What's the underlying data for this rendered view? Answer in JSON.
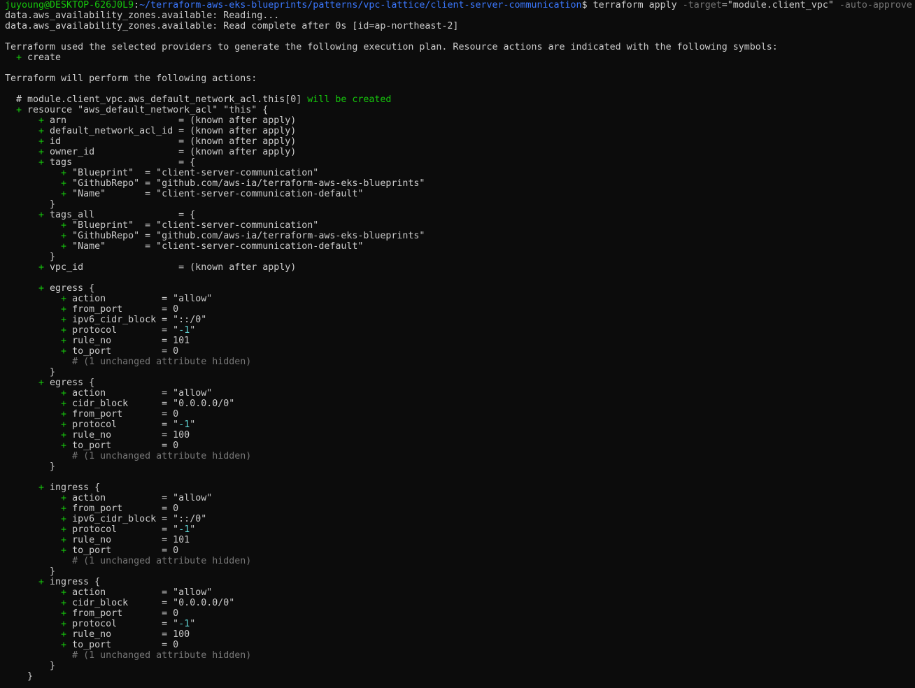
{
  "terminal": {
    "prompt": {
      "user_host": "juyoung@DESKTOP-626J0L9",
      "sep": ":",
      "path": "~/terraform-aws-eks-blueprints/patterns/vpc-lattice/client-server-communication",
      "dollar": "$ ",
      "command": "terraform apply ",
      "flag1": "-target",
      "flag1_value": "=\"module.client_vpc\" ",
      "flag2": "-auto-approve"
    },
    "colors": {
      "fg": "#cccccc",
      "green": "#16c60c",
      "blue": "#3b78ff",
      "cyan": "#61d6d6",
      "dim": "#767676",
      "background": "#0c0c0c"
    },
    "lines": [
      [
        {
          "t": "data.aws_availability_zones.available: Reading...",
          "c": "fg"
        }
      ],
      [
        {
          "t": "data.aws_availability_zones.available: Read complete after 0s [id=ap-northeast-2]",
          "c": "fg"
        }
      ],
      [],
      [
        {
          "t": "Terraform used the selected providers to generate the following execution plan. Resource actions are indicated with the following symbols:",
          "c": "fg"
        }
      ],
      [
        {
          "t": "  + ",
          "c": "grn"
        },
        {
          "t": "create",
          "c": "fg"
        }
      ],
      [],
      [
        {
          "t": "Terraform will perform the following actions:",
          "c": "fg"
        }
      ],
      [],
      [
        {
          "t": "  # module.client_vpc.aws_default_network_acl.this[0] ",
          "c": "fg"
        },
        {
          "t": "will be created",
          "c": "grn"
        }
      ],
      [
        {
          "t": "  + ",
          "c": "grn"
        },
        {
          "t": "resource \"aws_default_network_acl\" \"this\" {",
          "c": "fg"
        }
      ],
      [
        {
          "t": "      + ",
          "c": "grn"
        },
        {
          "t": "arn                    = (known after apply)",
          "c": "fg"
        }
      ],
      [
        {
          "t": "      + ",
          "c": "grn"
        },
        {
          "t": "default_network_acl_id = (known after apply)",
          "c": "fg"
        }
      ],
      [
        {
          "t": "      + ",
          "c": "grn"
        },
        {
          "t": "id                     = (known after apply)",
          "c": "fg"
        }
      ],
      [
        {
          "t": "      + ",
          "c": "grn"
        },
        {
          "t": "owner_id               = (known after apply)",
          "c": "fg"
        }
      ],
      [
        {
          "t": "      + ",
          "c": "grn"
        },
        {
          "t": "tags                   = {",
          "c": "fg"
        }
      ],
      [
        {
          "t": "          + ",
          "c": "grn"
        },
        {
          "t": "\"Blueprint\"  = \"client-server-communication\"",
          "c": "fg"
        }
      ],
      [
        {
          "t": "          + ",
          "c": "grn"
        },
        {
          "t": "\"GithubRepo\" = \"github.com/aws-ia/terraform-aws-eks-blueprints\"",
          "c": "fg"
        }
      ],
      [
        {
          "t": "          + ",
          "c": "grn"
        },
        {
          "t": "\"Name\"       = \"client-server-communication-default\"",
          "c": "fg"
        }
      ],
      [
        {
          "t": "        }",
          "c": "fg"
        }
      ],
      [
        {
          "t": "      + ",
          "c": "grn"
        },
        {
          "t": "tags_all               = {",
          "c": "fg"
        }
      ],
      [
        {
          "t": "          + ",
          "c": "grn"
        },
        {
          "t": "\"Blueprint\"  = \"client-server-communication\"",
          "c": "fg"
        }
      ],
      [
        {
          "t": "          + ",
          "c": "grn"
        },
        {
          "t": "\"GithubRepo\" = \"github.com/aws-ia/terraform-aws-eks-blueprints\"",
          "c": "fg"
        }
      ],
      [
        {
          "t": "          + ",
          "c": "grn"
        },
        {
          "t": "\"Name\"       = \"client-server-communication-default\"",
          "c": "fg"
        }
      ],
      [
        {
          "t": "        }",
          "c": "fg"
        }
      ],
      [
        {
          "t": "      + ",
          "c": "grn"
        },
        {
          "t": "vpc_id                 = (known after apply)",
          "c": "fg"
        }
      ],
      [],
      [
        {
          "t": "      + ",
          "c": "grn"
        },
        {
          "t": "egress {",
          "c": "fg"
        }
      ],
      [
        {
          "t": "          + ",
          "c": "grn"
        },
        {
          "t": "action          = \"allow\"",
          "c": "fg"
        }
      ],
      [
        {
          "t": "          + ",
          "c": "grn"
        },
        {
          "t": "from_port       = 0",
          "c": "fg"
        }
      ],
      [
        {
          "t": "          + ",
          "c": "grn"
        },
        {
          "t": "ipv6_cidr_block = \"::/0\"",
          "c": "fg"
        }
      ],
      [
        {
          "t": "          + ",
          "c": "grn"
        },
        {
          "t": "protocol        = \"",
          "c": "fg"
        },
        {
          "t": "-1",
          "c": "cyn"
        },
        {
          "t": "\"",
          "c": "fg"
        }
      ],
      [
        {
          "t": "          + ",
          "c": "grn"
        },
        {
          "t": "rule_no         = 101",
          "c": "fg"
        }
      ],
      [
        {
          "t": "          + ",
          "c": "grn"
        },
        {
          "t": "to_port         = 0",
          "c": "fg"
        }
      ],
      [
        {
          "t": "            # (1 unchanged attribute hidden)",
          "c": "dim"
        }
      ],
      [
        {
          "t": "        }",
          "c": "fg"
        }
      ],
      [
        {
          "t": "      + ",
          "c": "grn"
        },
        {
          "t": "egress {",
          "c": "fg"
        }
      ],
      [
        {
          "t": "          + ",
          "c": "grn"
        },
        {
          "t": "action          = \"allow\"",
          "c": "fg"
        }
      ],
      [
        {
          "t": "          + ",
          "c": "grn"
        },
        {
          "t": "cidr_block      = \"0.0.0.0/0\"",
          "c": "fg"
        }
      ],
      [
        {
          "t": "          + ",
          "c": "grn"
        },
        {
          "t": "from_port       = 0",
          "c": "fg"
        }
      ],
      [
        {
          "t": "          + ",
          "c": "grn"
        },
        {
          "t": "protocol        = \"",
          "c": "fg"
        },
        {
          "t": "-1",
          "c": "cyn"
        },
        {
          "t": "\"",
          "c": "fg"
        }
      ],
      [
        {
          "t": "          + ",
          "c": "grn"
        },
        {
          "t": "rule_no         = 100",
          "c": "fg"
        }
      ],
      [
        {
          "t": "          + ",
          "c": "grn"
        },
        {
          "t": "to_port         = 0",
          "c": "fg"
        }
      ],
      [
        {
          "t": "            # (1 unchanged attribute hidden)",
          "c": "dim"
        }
      ],
      [
        {
          "t": "        }",
          "c": "fg"
        }
      ],
      [],
      [
        {
          "t": "      + ",
          "c": "grn"
        },
        {
          "t": "ingress {",
          "c": "fg"
        }
      ],
      [
        {
          "t": "          + ",
          "c": "grn"
        },
        {
          "t": "action          = \"allow\"",
          "c": "fg"
        }
      ],
      [
        {
          "t": "          + ",
          "c": "grn"
        },
        {
          "t": "from_port       = 0",
          "c": "fg"
        }
      ],
      [
        {
          "t": "          + ",
          "c": "grn"
        },
        {
          "t": "ipv6_cidr_block = \"::/0\"",
          "c": "fg"
        }
      ],
      [
        {
          "t": "          + ",
          "c": "grn"
        },
        {
          "t": "protocol        = \"",
          "c": "fg"
        },
        {
          "t": "-1",
          "c": "cyn"
        },
        {
          "t": "\"",
          "c": "fg"
        }
      ],
      [
        {
          "t": "          + ",
          "c": "grn"
        },
        {
          "t": "rule_no         = 101",
          "c": "fg"
        }
      ],
      [
        {
          "t": "          + ",
          "c": "grn"
        },
        {
          "t": "to_port         = 0",
          "c": "fg"
        }
      ],
      [
        {
          "t": "            # (1 unchanged attribute hidden)",
          "c": "dim"
        }
      ],
      [
        {
          "t": "        }",
          "c": "fg"
        }
      ],
      [
        {
          "t": "      + ",
          "c": "grn"
        },
        {
          "t": "ingress {",
          "c": "fg"
        }
      ],
      [
        {
          "t": "          + ",
          "c": "grn"
        },
        {
          "t": "action          = \"allow\"",
          "c": "fg"
        }
      ],
      [
        {
          "t": "          + ",
          "c": "grn"
        },
        {
          "t": "cidr_block      = \"0.0.0.0/0\"",
          "c": "fg"
        }
      ],
      [
        {
          "t": "          + ",
          "c": "grn"
        },
        {
          "t": "from_port       = 0",
          "c": "fg"
        }
      ],
      [
        {
          "t": "          + ",
          "c": "grn"
        },
        {
          "t": "protocol        = \"",
          "c": "fg"
        },
        {
          "t": "-1",
          "c": "cyn"
        },
        {
          "t": "\"",
          "c": "fg"
        }
      ],
      [
        {
          "t": "          + ",
          "c": "grn"
        },
        {
          "t": "rule_no         = 100",
          "c": "fg"
        }
      ],
      [
        {
          "t": "          + ",
          "c": "grn"
        },
        {
          "t": "to_port         = 0",
          "c": "fg"
        }
      ],
      [
        {
          "t": "            # (1 unchanged attribute hidden)",
          "c": "dim"
        }
      ],
      [
        {
          "t": "        }",
          "c": "fg"
        }
      ],
      [
        {
          "t": "    }",
          "c": "fg"
        }
      ]
    ]
  }
}
